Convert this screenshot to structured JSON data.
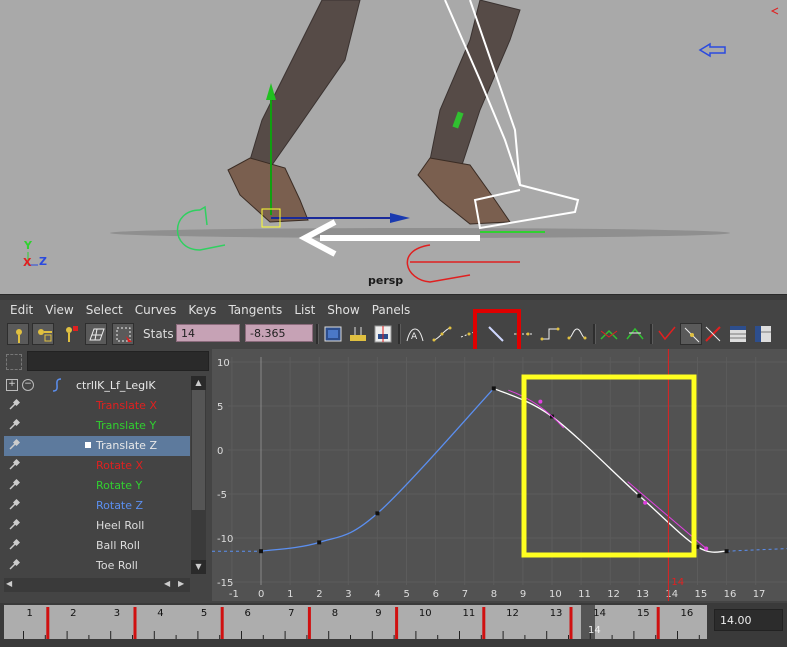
{
  "viewport": {
    "camera_label": "persp",
    "axis_y": "Y",
    "axis_x": "X",
    "axis_z": "Z"
  },
  "menu": [
    "Edit",
    "View",
    "Select",
    "Curves",
    "Keys",
    "Tangents",
    "List",
    "Show",
    "Panels"
  ],
  "toolbar": {
    "stats_label": "Stats",
    "stat_frame": "14",
    "stat_value": "-8.365"
  },
  "outliner": {
    "node_name": "ctrlIK_Lf_LegIK",
    "channels": [
      {
        "label": "Translate X",
        "color": "#e02020"
      },
      {
        "label": "Translate Y",
        "color": "#30d030"
      },
      {
        "label": "Translate Z",
        "color": "#e8e8e8",
        "selected": true
      },
      {
        "label": "Rotate X",
        "color": "#e02020"
      },
      {
        "label": "Rotate Y",
        "color": "#30d030"
      },
      {
        "label": "Rotate Z",
        "color": "#5b8ff0"
      },
      {
        "label": "Heel Roll",
        "color": "#dddddd"
      },
      {
        "label": "Ball Roll",
        "color": "#dddddd"
      },
      {
        "label": "Toe Roll",
        "color": "#dddddd"
      }
    ]
  },
  "graph": {
    "y_ticks": [
      "10",
      "5",
      "0",
      "-5",
      "-10",
      "-15"
    ],
    "x_ticks": [
      "-1",
      "0",
      "1",
      "2",
      "3",
      "4",
      "5",
      "6",
      "7",
      "8",
      "9",
      "10",
      "11",
      "12",
      "13",
      "14",
      "15",
      "16",
      "17"
    ],
    "current_frame_label": "14",
    "curve_keys": [
      [
        0,
        -11.5
      ],
      [
        2,
        -10.5
      ],
      [
        4,
        -7.2
      ],
      [
        8,
        7
      ],
      [
        10,
        3.8
      ],
      [
        13,
        -5.2
      ],
      [
        15,
        -11
      ],
      [
        16,
        -11.5
      ]
    ],
    "curve_color": "#5b8ff0",
    "selected_curve_color": "#ffffff",
    "highlight_color": "#ffff20"
  },
  "timeline": {
    "numbers": [
      "1",
      "2",
      "3",
      "4",
      "5",
      "6",
      "7",
      "8",
      "9",
      "10",
      "11",
      "12",
      "13",
      "14",
      "15",
      "16"
    ],
    "current_label": "14",
    "current_frame_field": "14.00"
  }
}
